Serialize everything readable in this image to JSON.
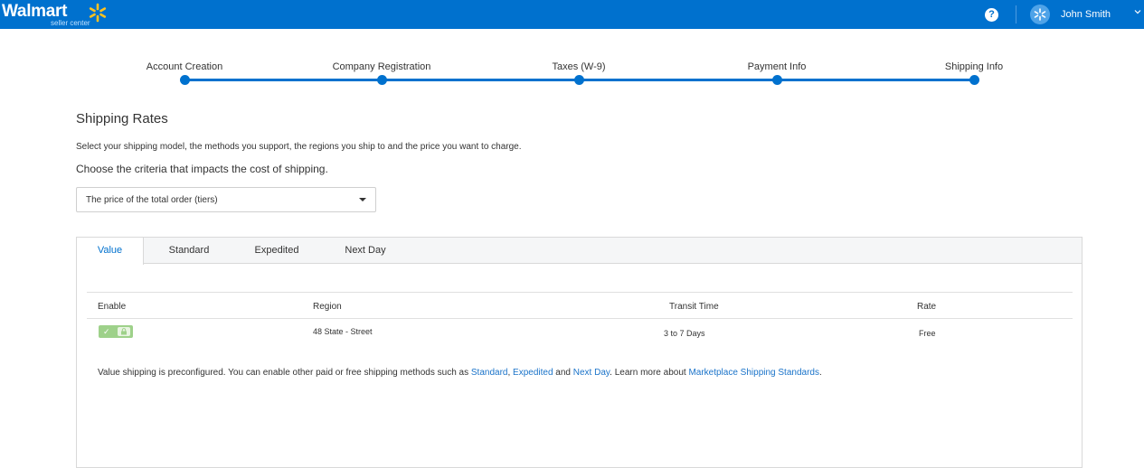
{
  "header": {
    "logo_text": "Walmart",
    "logo_subtext": "seller center",
    "help_label": "?",
    "user_name": "John Smith",
    "icons": [
      "spark-icon",
      "help-icon",
      "avatar-icon",
      "chevron-down-icon"
    ]
  },
  "stepper": {
    "steps": [
      {
        "label": "Account Creation"
      },
      {
        "label": "Company Registration"
      },
      {
        "label": "Taxes (W-9)"
      },
      {
        "label": "Payment Info"
      },
      {
        "label": "Shipping Info"
      }
    ]
  },
  "page": {
    "title": "Shipping Rates",
    "description": "Select your shipping model, the methods you support, the regions you ship to and the price you want to charge.",
    "criteria_label": "Choose the criteria that impacts the cost of shipping.",
    "criteria_select": "The price of the total order (tiers)"
  },
  "tabs": [
    {
      "label": "Value",
      "active": true
    },
    {
      "label": "Standard",
      "active": false
    },
    {
      "label": "Expedited",
      "active": false
    },
    {
      "label": "Next Day",
      "active": false
    }
  ],
  "table": {
    "headers": {
      "enable": "Enable",
      "region": "Region",
      "transit": "Transit Time",
      "rate": "Rate"
    },
    "rows": [
      {
        "enabled": true,
        "locked": true,
        "region": "48 State - Street",
        "transit": "3 to 7 Days",
        "rate": "Free"
      }
    ]
  },
  "note": {
    "text_1": "Value shipping is preconfigured. You can enable other paid or free shipping methods such as ",
    "link_standard": "Standard",
    "sep_1": ", ",
    "link_expedited": "Expedited",
    "text_2": " and ",
    "link_next_day": "Next Day",
    "text_3": ". Learn more about ",
    "link_standards": "Marketplace Shipping Standards",
    "text_4": "."
  },
  "colors": {
    "brand": "#0071ce",
    "spark": "#ffc220",
    "toggle_on": "#9ed18a",
    "link": "#1a73c9"
  }
}
